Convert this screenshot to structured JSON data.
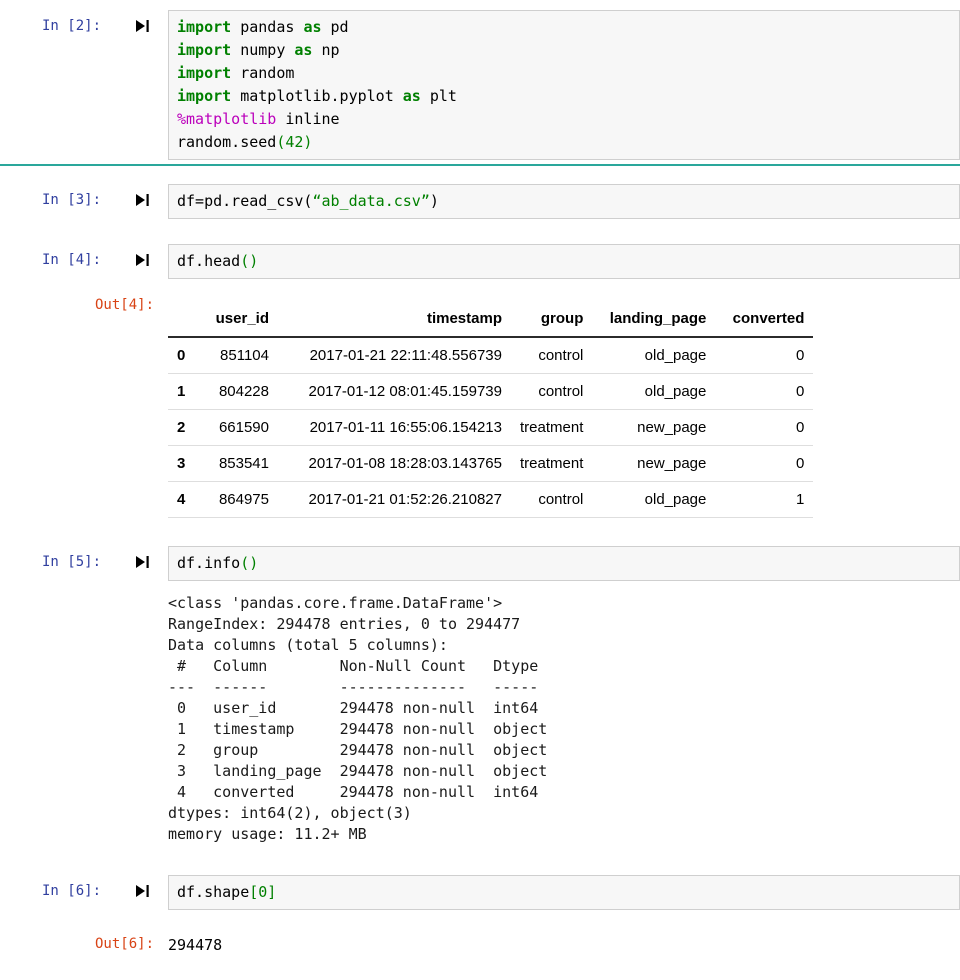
{
  "colors": {
    "prompt_in": "#303F9F",
    "prompt_out": "#D84315",
    "keyword_green": "#008000",
    "magic_magenta": "#BB00BB",
    "cell_divider_teal": "#2AA79B",
    "input_bg": "#F7F7F7",
    "input_border": "#CFCFCF"
  },
  "cells": {
    "c2": {
      "prompt": "In [2]:",
      "lines": [
        [
          {
            "t": "import",
            "c": "kw"
          },
          {
            "t": " pandas ",
            "c": "pl"
          },
          {
            "t": "as",
            "c": "kw"
          },
          {
            "t": " pd",
            "c": "pl"
          }
        ],
        [
          {
            "t": "import",
            "c": "kw"
          },
          {
            "t": " numpy ",
            "c": "pl"
          },
          {
            "t": "as",
            "c": "kw"
          },
          {
            "t": " np",
            "c": "pl"
          }
        ],
        [
          {
            "t": "import",
            "c": "kw"
          },
          {
            "t": " random",
            "c": "pl"
          }
        ],
        [
          {
            "t": "import",
            "c": "kw"
          },
          {
            "t": " matplotlib.pyplot ",
            "c": "pl"
          },
          {
            "t": "as",
            "c": "kw"
          },
          {
            "t": " plt",
            "c": "pl"
          }
        ],
        [
          {
            "t": "%matplotlib",
            "c": "mg"
          },
          {
            "t": " inline",
            "c": "pl"
          }
        ],
        [
          {
            "t": "random.seed",
            "c": "pl"
          },
          {
            "t": "(42)",
            "c": "nm"
          }
        ]
      ]
    },
    "c3": {
      "prompt": "In [3]:",
      "lines": [
        [
          {
            "t": "df=pd.read_csv(",
            "c": "pl"
          },
          {
            "t": "“ab_data.csv”",
            "c": "st"
          },
          {
            "t": ")",
            "c": "pl"
          }
        ]
      ]
    },
    "c4": {
      "prompt": "In [4]:",
      "lines": [
        [
          {
            "t": "df.head",
            "c": "pl"
          },
          {
            "t": "()",
            "c": "nm"
          }
        ]
      ]
    },
    "out4": {
      "prompt": "Out[4]:",
      "table": {
        "columns": [
          "",
          "user_id",
          "timestamp",
          "group",
          "landing_page",
          "converted"
        ],
        "rows": [
          [
            "0",
            "851104",
            "2017-01-21 22:11:48.556739",
            "control",
            "old_page",
            "0"
          ],
          [
            "1",
            "804228",
            "2017-01-12 08:01:45.159739",
            "control",
            "old_page",
            "0"
          ],
          [
            "2",
            "661590",
            "2017-01-11 16:55:06.154213",
            "treatment",
            "new_page",
            "0"
          ],
          [
            "3",
            "853541",
            "2017-01-08 18:28:03.143765",
            "treatment",
            "new_page",
            "0"
          ],
          [
            "4",
            "864975",
            "2017-01-21 01:52:26.210827",
            "control",
            "old_page",
            "1"
          ]
        ]
      }
    },
    "c5": {
      "prompt": "In [5]:",
      "lines": [
        [
          {
            "t": "df.info",
            "c": "pl"
          },
          {
            "t": "()",
            "c": "nm"
          }
        ]
      ]
    },
    "info_output": {
      "text": "<class 'pandas.core.frame.DataFrame'>\nRangeIndex: 294478 entries, 0 to 294477\nData columns (total 5 columns):\n #   Column        Non-Null Count   Dtype \n---  ------        --------------   ----- \n 0   user_id       294478 non-null  int64 \n 1   timestamp     294478 non-null  object\n 2   group         294478 non-null  object\n 3   landing_page  294478 non-null  object\n 4   converted     294478 non-null  int64 \ndtypes: int64(2), object(3)\nmemory usage: 11.2+ MB"
    },
    "c6": {
      "prompt": "In [6]:",
      "lines": [
        [
          {
            "t": "df.shape",
            "c": "pl"
          },
          {
            "t": "[0]",
            "c": "nm"
          }
        ]
      ]
    },
    "out6": {
      "prompt": "Out[6]:",
      "value": "294478"
    }
  }
}
